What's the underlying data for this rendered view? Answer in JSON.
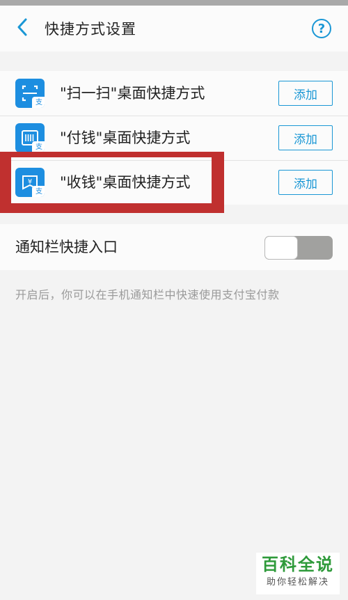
{
  "header": {
    "title": "快捷方式设置",
    "back_icon": "chevron-left-icon",
    "help_label": "?"
  },
  "shortcuts": [
    {
      "label": "\"扫一扫\"桌面快捷方式",
      "button": "添加",
      "icon": "scan-icon"
    },
    {
      "label": "\"付钱\"桌面快捷方式",
      "button": "添加",
      "icon": "barcode-pay-icon"
    },
    {
      "label": "\"收钱\"桌面快捷方式",
      "button": "添加",
      "icon": "receive-money-icon"
    }
  ],
  "notification": {
    "label": "通知栏快捷入口",
    "toggle_on": false
  },
  "hint": "开启后，你可以在手机通知栏中快速使用支付宝付款",
  "icon_tag": "支",
  "watermark": {
    "title": "百科全说",
    "subtitle": "助你轻松解决"
  },
  "colors": {
    "accent": "#1a97d5",
    "icon_bg": "#1d8ee0",
    "highlight": "#c0302f",
    "toggle_off": "#a1a19f",
    "watermark_green": "#2e9a3a"
  }
}
